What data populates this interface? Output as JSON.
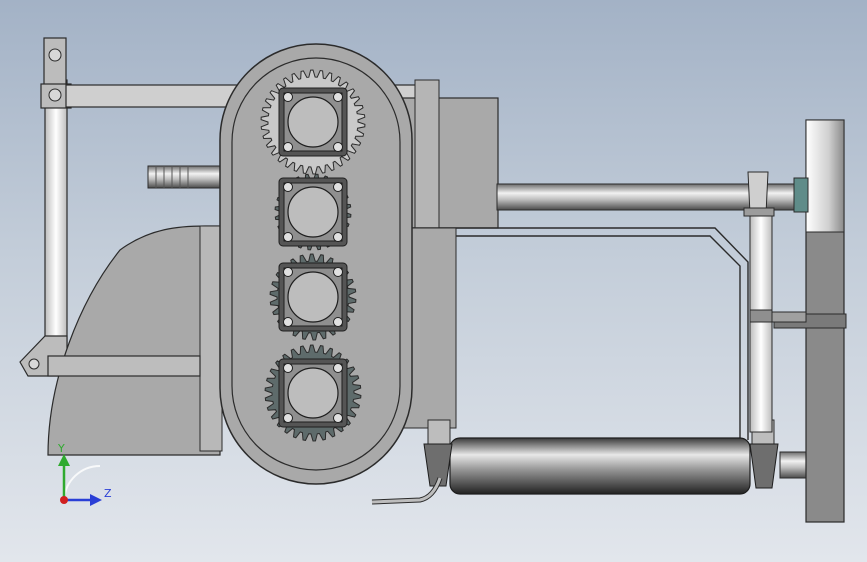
{
  "viewport": {
    "background_top": "#a3b2c6",
    "background_bottom": "#e2e6ec"
  },
  "triad": {
    "y_label": "Y",
    "z_label": "Z",
    "y_color": "#2faa2f",
    "z_color": "#2a3fd6",
    "x_color": "#d02020"
  },
  "model": {
    "body_color": "#a9a9a9",
    "edge_color": "#2b2b2b",
    "gear_dark_color": "#5e6b6b",
    "gear_light_color": "#c9c9c9",
    "gear_count": 4
  }
}
